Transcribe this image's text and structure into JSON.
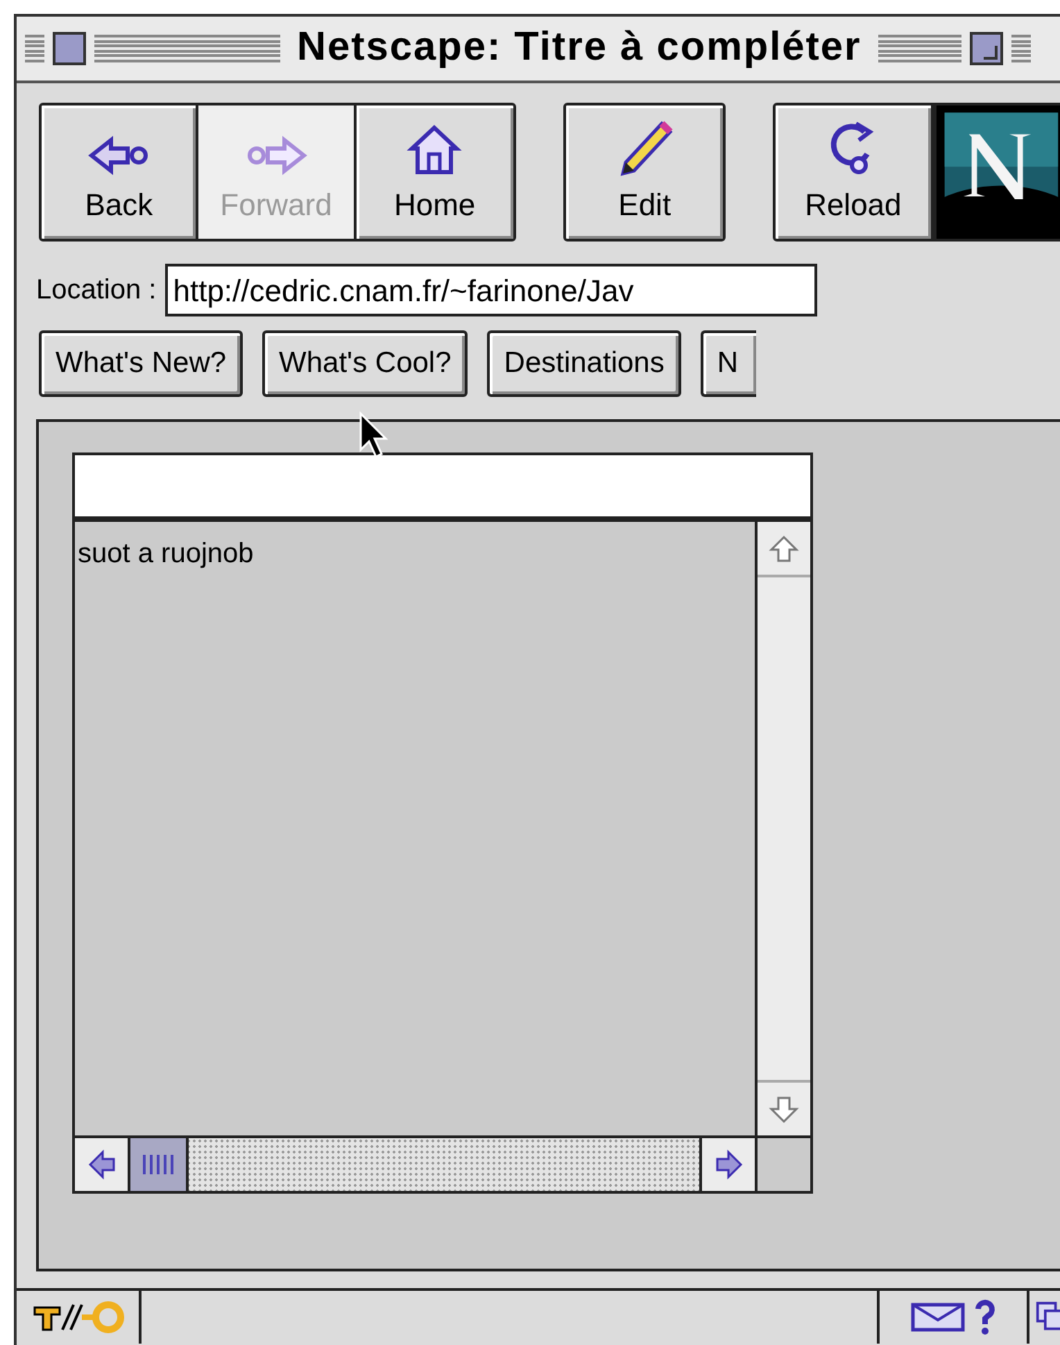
{
  "window": {
    "title": "Netscape: Titre à compléter"
  },
  "toolbar": [
    {
      "kind": "back",
      "label": "Back",
      "disabled": false
    },
    {
      "kind": "forward",
      "label": "Forward",
      "disabled": true
    },
    {
      "kind": "home",
      "label": "Home",
      "disabled": false
    },
    {
      "kind": "edit",
      "label": "Edit",
      "disabled": false
    },
    {
      "kind": "reload",
      "label": "Reload",
      "disabled": false
    }
  ],
  "location": {
    "label": "Location :",
    "value": "http://cedric.cnam.fr/~farinone/Jav"
  },
  "directory_buttons": [
    "What's New?",
    "What's Cool?",
    "Destinations",
    "N"
  ],
  "content": {
    "text_area": {
      "value": "suot a ruojnob"
    }
  }
}
